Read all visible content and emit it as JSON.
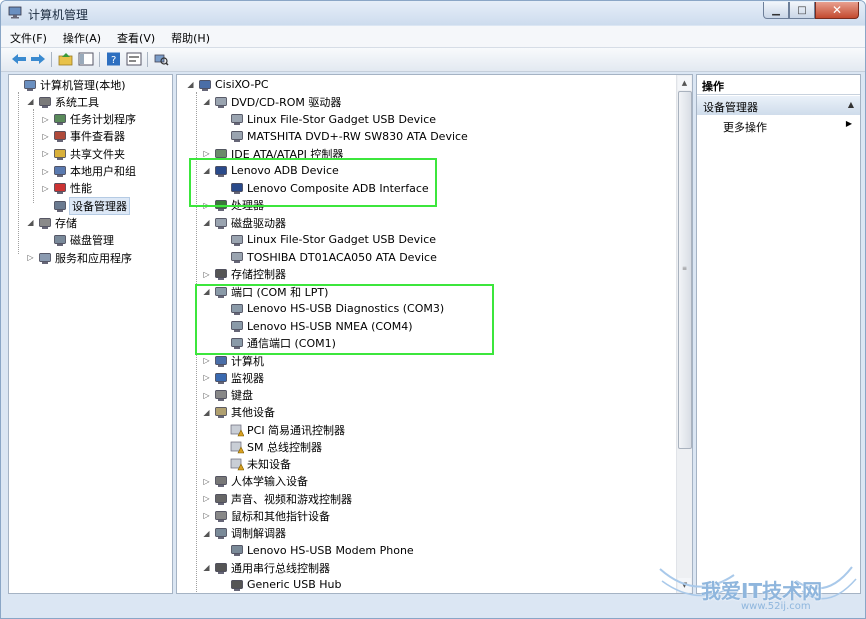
{
  "window": {
    "title": "计算机管理"
  },
  "menu": [
    "文件(F)",
    "操作(A)",
    "查看(V)",
    "帮助(H)"
  ],
  "left_tree": [
    {
      "label": "计算机管理(本地)",
      "level": 0,
      "expander": "",
      "icon": "computer-management-icon"
    },
    {
      "label": "系统工具",
      "level": 1,
      "expander": "open",
      "icon": "tools-icon"
    },
    {
      "label": "任务计划程序",
      "level": 2,
      "expander": "closed",
      "icon": "clock-icon"
    },
    {
      "label": "事件查看器",
      "level": 2,
      "expander": "closed",
      "icon": "event-viewer-icon"
    },
    {
      "label": "共享文件夹",
      "level": 2,
      "expander": "closed",
      "icon": "shared-folder-icon"
    },
    {
      "label": "本地用户和组",
      "level": 2,
      "expander": "closed",
      "icon": "users-icon"
    },
    {
      "label": "性能",
      "level": 2,
      "expander": "closed",
      "icon": "performance-icon"
    },
    {
      "label": "设备管理器",
      "level": 2,
      "expander": "",
      "icon": "device-manager-icon",
      "selected": true
    },
    {
      "label": "存储",
      "level": 1,
      "expander": "open",
      "icon": "storage-icon"
    },
    {
      "label": "磁盘管理",
      "level": 2,
      "expander": "",
      "icon": "disk-management-icon"
    },
    {
      "label": "服务和应用程序",
      "level": 1,
      "expander": "closed",
      "icon": "services-icon"
    }
  ],
  "device_tree": [
    {
      "label": "CisiXO-PC",
      "level": 0,
      "expander": "open",
      "icon": "computer-icon"
    },
    {
      "label": "DVD/CD-ROM 驱动器",
      "level": 1,
      "expander": "open",
      "icon": "dvd-drive-icon"
    },
    {
      "label": "Linux File-Stor Gadget USB Device",
      "level": 2,
      "expander": "",
      "icon": "dvd-drive-icon"
    },
    {
      "label": "MATSHITA DVD+-RW SW830 ATA Device",
      "level": 2,
      "expander": "",
      "icon": "dvd-drive-icon"
    },
    {
      "label": "IDE ATA/ATAPI 控制器",
      "level": 1,
      "expander": "closed",
      "icon": "ide-controller-icon"
    },
    {
      "label": "Lenovo ADB Device",
      "level": 1,
      "expander": "open",
      "icon": "adb-device-icon"
    },
    {
      "label": "Lenovo Composite ADB Interface",
      "level": 2,
      "expander": "",
      "icon": "adb-device-icon"
    },
    {
      "label": "处理器",
      "level": 1,
      "expander": "closed",
      "icon": "processor-icon"
    },
    {
      "label": "磁盘驱动器",
      "level": 1,
      "expander": "open",
      "icon": "disk-drive-icon"
    },
    {
      "label": "Linux File-Stor Gadget USB Device",
      "level": 2,
      "expander": "",
      "icon": "disk-drive-icon"
    },
    {
      "label": "TOSHIBA DT01ACA050 ATA Device",
      "level": 2,
      "expander": "",
      "icon": "disk-drive-icon"
    },
    {
      "label": "存储控制器",
      "level": 1,
      "expander": "closed",
      "icon": "storage-controller-icon"
    },
    {
      "label": "端口 (COM 和 LPT)",
      "level": 1,
      "expander": "open",
      "icon": "port-icon"
    },
    {
      "label": "Lenovo HS-USB Diagnostics (COM3)",
      "level": 2,
      "expander": "",
      "icon": "port-icon"
    },
    {
      "label": "Lenovo HS-USB NMEA (COM4)",
      "level": 2,
      "expander": "",
      "icon": "port-icon"
    },
    {
      "label": "通信端口 (COM1)",
      "level": 2,
      "expander": "",
      "icon": "port-icon"
    },
    {
      "label": "计算机",
      "level": 1,
      "expander": "closed",
      "icon": "computer-icon"
    },
    {
      "label": "监视器",
      "level": 1,
      "expander": "closed",
      "icon": "monitor-icon"
    },
    {
      "label": "键盘",
      "level": 1,
      "expander": "closed",
      "icon": "keyboard-icon"
    },
    {
      "label": "其他设备",
      "level": 1,
      "expander": "open",
      "icon": "unknown-device-icon"
    },
    {
      "label": "PCI 简易通讯控制器",
      "level": 2,
      "expander": "",
      "icon": "warning-device-icon"
    },
    {
      "label": "SM 总线控制器",
      "level": 2,
      "expander": "",
      "icon": "warning-device-icon"
    },
    {
      "label": "未知设备",
      "level": 2,
      "expander": "",
      "icon": "warning-device-icon"
    },
    {
      "label": "人体学输入设备",
      "level": 1,
      "expander": "closed",
      "icon": "hid-icon"
    },
    {
      "label": "声音、视频和游戏控制器",
      "level": 1,
      "expander": "closed",
      "icon": "sound-icon"
    },
    {
      "label": "鼠标和其他指针设备",
      "level": 1,
      "expander": "closed",
      "icon": "mouse-icon"
    },
    {
      "label": "调制解调器",
      "level": 1,
      "expander": "open",
      "icon": "modem-icon"
    },
    {
      "label": "Lenovo HS-USB Modem Phone",
      "level": 2,
      "expander": "",
      "icon": "modem-icon"
    },
    {
      "label": "通用串行总线控制器",
      "level": 1,
      "expander": "open",
      "icon": "usb-icon"
    },
    {
      "label": "Generic USB Hub",
      "level": 2,
      "expander": "",
      "icon": "usb-icon"
    }
  ],
  "actions": {
    "header": "操作",
    "section": "设备管理器",
    "items": [
      "更多操作"
    ]
  },
  "watermark": {
    "text": "我爱IT技术网",
    "url": "www.52ij.com"
  },
  "colors": {
    "highlight_box": "#3ce63c",
    "selection": "#dde8f6",
    "window_frame": "#dbe6f3"
  }
}
